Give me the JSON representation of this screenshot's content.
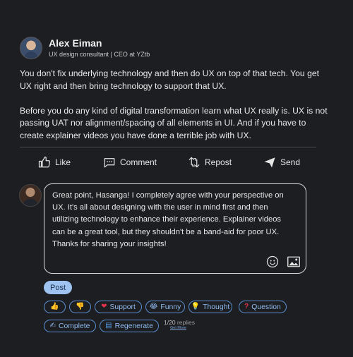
{
  "post": {
    "author_name": "Alex Eiman",
    "author_title": "UX design consultant | CEO at YZtb",
    "paragraph_1": "You don't fix underlying technology and then do UX on top of that tech. You get UX right and then bring technology to support that UX.",
    "paragraph_2": "Before you do any kind of digital transformation learn what UX really is. UX is not passing UAT nor alignment/spacing of all elements in UI. And if you have to create explainer videos you have done a terrible job with UX."
  },
  "actions": {
    "like": "Like",
    "comment": "Comment",
    "repost": "Repost",
    "send": "Send"
  },
  "reply": {
    "text": "Great point, Hasanga! I completely agree with your perspective on UX. It's all about designing with the user in mind first and then utilizing technology to enhance their experience. Explainer videos can be a great tool, but they shouldn't be a band-aid for poor UX. Thanks for sharing your insights!",
    "post_label": "Post"
  },
  "chips": {
    "support": "Support",
    "funny": "Funny",
    "thought": "Thought",
    "question": "Question",
    "complete": "Complete",
    "regenerate": "Regenerate"
  },
  "replies": {
    "count": "1/20",
    "label": "replies",
    "get_more": "Get More"
  },
  "colors": {
    "background": "#1c1e21",
    "accent": "#8fbaf0",
    "post_button": "#9fc3f0"
  }
}
